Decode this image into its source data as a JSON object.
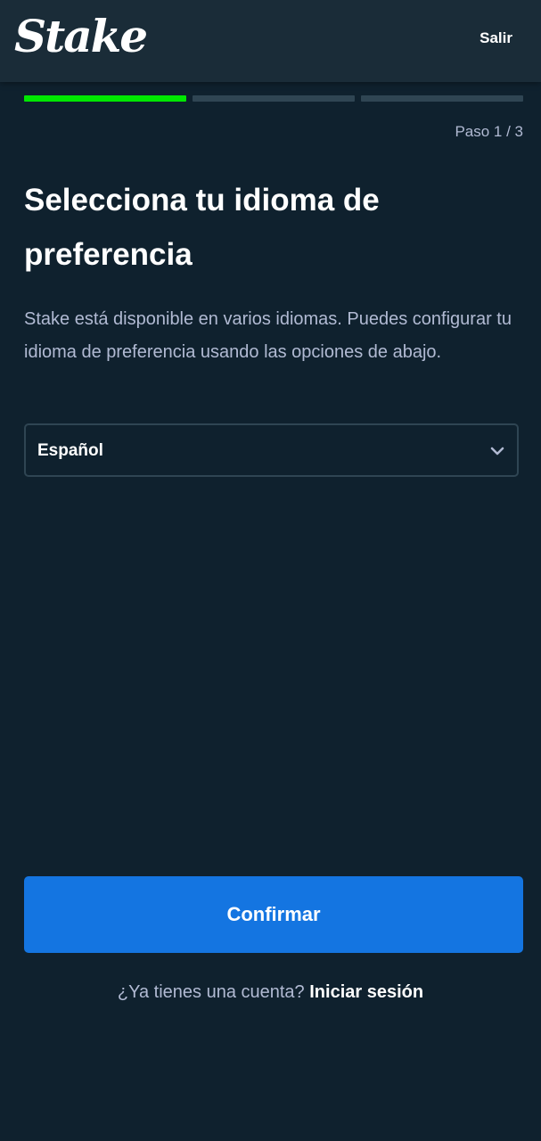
{
  "header": {
    "logo_text": "Stake",
    "exit_label": "Salir"
  },
  "progress": {
    "total_steps": 3,
    "current_step": 1,
    "step_label": "Paso 1 / 3",
    "active_color": "#00e701",
    "inactive_color": "#2f4553"
  },
  "main": {
    "title": "Selecciona tu idioma de preferencia",
    "description": "Stake está disponible en varios idiomas. Puedes configurar tu idioma de preferencia usando las opciones de abajo.",
    "language_select": {
      "selected_value": "Español",
      "icon": "chevron-down-icon"
    }
  },
  "footer": {
    "confirm_label": "Confirmar",
    "account_prompt": "¿Ya tienes una cuenta?",
    "login_label": "Iniciar sesión",
    "accent_color": "#1475e1"
  }
}
